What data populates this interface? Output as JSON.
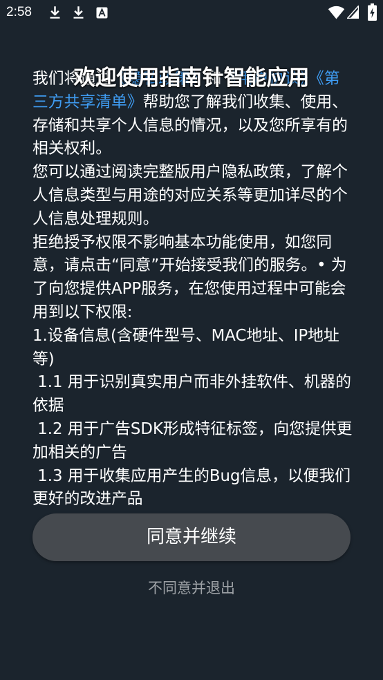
{
  "status_bar": {
    "time": "2:58",
    "icons": [
      "download-icon",
      "download-icon",
      "text-a-icon",
      "wifi-icon",
      "signal-icon",
      "battery-charging-icon"
    ]
  },
  "dialog": {
    "title": "欢迎使用指南针智能应用",
    "body_lines": [
      [
        {
          "text": "我们将通过"
        },
        {
          "text": "《隐私政策》",
          "link": true
        },
        {
          "text": "和"
        },
        {
          "text": "《用户协议》",
          "link": true
        },
        {
          "text": "《第",
          "link": true
        }
      ],
      [
        {
          "text": "三方共享清单》",
          "link": true
        },
        {
          "text": "帮助您了解我们收集、使用、"
        }
      ],
      [
        {
          "text": "存储和共享个人信息的情况，以及您所享有的"
        }
      ],
      [
        {
          "text": "相关权利。"
        }
      ],
      [
        {
          "text": "您可以通过阅读完整版用户隐私政策，了解个"
        }
      ],
      [
        {
          "text": "人信息类型与用途的对应关系等更加详尽的个"
        }
      ],
      [
        {
          "text": "人信息处理规则。"
        }
      ],
      [
        {
          "text": "拒绝授予权限不影响基本功能使用，如您同"
        }
      ],
      [
        {
          "text": "意，请点击“同意”开始接受我们的服务。• 为"
        }
      ],
      [
        {
          "text": "了向您提供APP服务，在您使用过程中可能会"
        }
      ],
      [
        {
          "text": "用到以下权限:"
        }
      ],
      [
        {
          "text": "1.设备信息(含硬件型号、MAC地址、IP地址"
        }
      ],
      [
        {
          "text": "等)"
        }
      ],
      [
        {
          "text": " 1.1 用于识别真实用户而非外挂软件、机器的"
        }
      ],
      [
        {
          "text": "依据"
        }
      ],
      [
        {
          "text": " 1.2 用于广告SDK形成特征标签，向您提供更"
        }
      ],
      [
        {
          "text": "加相关的广告"
        }
      ],
      [
        {
          "text": " 1.3 用于收集应用产生的Bug信息，以便我们"
        }
      ],
      [
        {
          "text": "更好的改进产品"
        }
      ]
    ],
    "agree_button": "同意并继续",
    "decline_link": "不同意并退出"
  },
  "colors": {
    "background": "#1b242d",
    "text": "#ffffff",
    "link": "#3f9cf2",
    "button": "#464a4f",
    "muted": "#9ea2a6"
  }
}
